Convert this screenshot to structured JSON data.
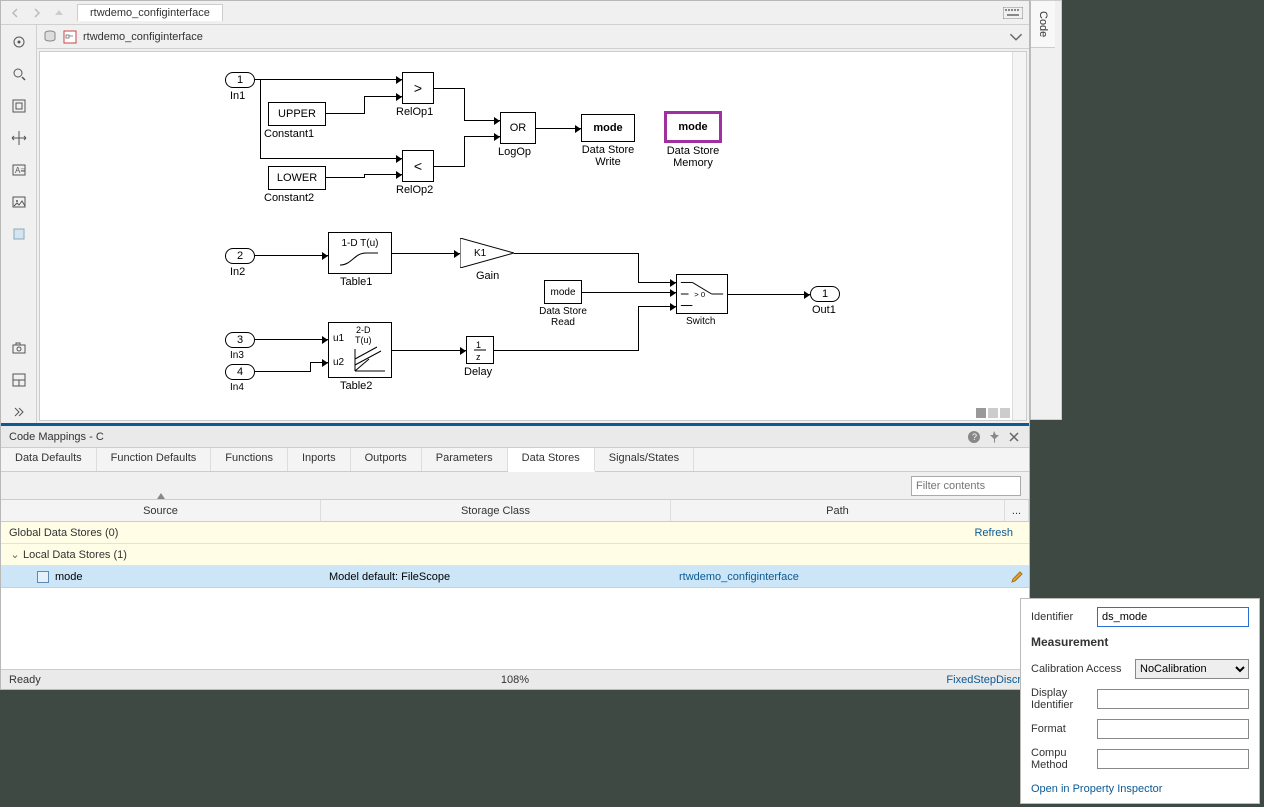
{
  "window": {
    "tab": "rtwdemo_configinterface"
  },
  "breadcrumb": {
    "model": "rtwdemo_configinterface"
  },
  "sidePanel": {
    "codeTab": "Code"
  },
  "diagram": {
    "in1": "In1",
    "in1_num": "1",
    "in2": "In2",
    "in2_num": "2",
    "in3": "In3",
    "in3_num": "3",
    "in4": "In4",
    "in4_num": "4",
    "out1": "Out1",
    "out1_num": "1",
    "constant1": "Constant1",
    "constant1_val": "UPPER",
    "constant2": "Constant2",
    "constant2_val": "LOWER",
    "relop1": "RelOp1",
    "relop1_sym": ">",
    "relop2": "RelOp2",
    "relop2_sym": "<",
    "logop": "LogOp",
    "logop_sym": "OR",
    "dsw": "Data Store\nWrite",
    "dsw_val": "mode",
    "dsm": "Data Store\nMemory",
    "dsm_val": "mode",
    "dsr": "Data Store\nRead",
    "dsr_val": "mode",
    "table1": "Table1",
    "table1_val": "1-D T(u)",
    "table2": "Table2",
    "table2_val": "2-D\nT(u)",
    "table2_u1": "u1",
    "table2_u2": "u2",
    "gain": "Gain",
    "gain_val": "K1",
    "delay": "Delay",
    "delay_val": "1/z",
    "switch": "Switch",
    "switch_val": "> 0"
  },
  "codeMappings": {
    "title": "Code Mappings - C",
    "tabs": [
      "Data Defaults",
      "Function Defaults",
      "Functions",
      "Inports",
      "Outports",
      "Parameters",
      "Data Stores",
      "Signals/States"
    ],
    "activeTab": "Data Stores",
    "filterPlaceholder": "Filter contents",
    "columns": {
      "source": "Source",
      "storageClass": "Storage Class",
      "path": "Path",
      "end": "..."
    },
    "globalGroup": "Global Data Stores (0)",
    "refresh": "Refresh",
    "localGroup": "Local Data Stores (1)",
    "row": {
      "name": "mode",
      "storageClass": "Model default: FileScope",
      "path": "rtwdemo_configinterface"
    }
  },
  "statusBar": {
    "ready": "Ready",
    "zoom": "108%",
    "solver": "FixedStepDiscr"
  },
  "props": {
    "identifierLabel": "Identifier",
    "identifierValue": "ds_mode",
    "measurementHead": "Measurement",
    "calibLabel": "Calibration Access",
    "calibValue": "NoCalibration",
    "displayIdLabel": "Display Identifier",
    "displayIdValue": "",
    "formatLabel": "Format",
    "formatValue": "",
    "compuLabel": "Compu Method",
    "compuValue": "",
    "openLink": "Open in Property Inspector"
  }
}
